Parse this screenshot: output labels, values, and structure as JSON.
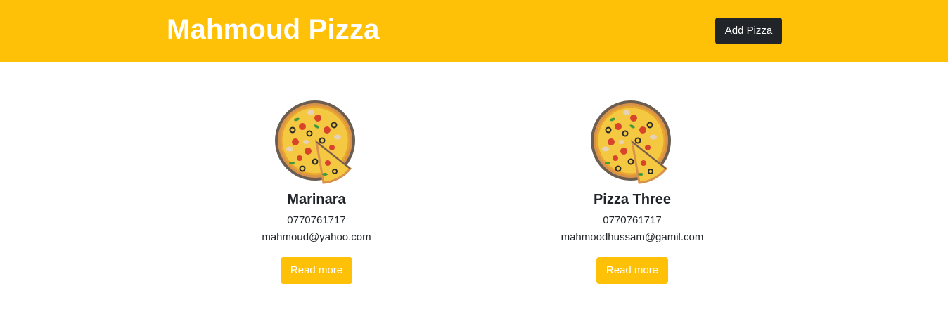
{
  "header": {
    "brand": "Mahmoud Pizza",
    "add_button_label": "Add Pizza"
  },
  "pizzas": [
    {
      "name": "Marinara",
      "phone": "0770761717",
      "email": "mahmoud@yahoo.com",
      "button_label": "Read more",
      "image_icon": "pizza-icon"
    },
    {
      "name": "Pizza Three",
      "phone": "0770761717",
      "email": "mahmoodhussam@gamil.com",
      "button_label": "Read more",
      "image_icon": "pizza-icon"
    }
  ],
  "colors": {
    "navbar": "#ffc107",
    "dark_button": "#212529",
    "accent_button": "#ffc107"
  }
}
